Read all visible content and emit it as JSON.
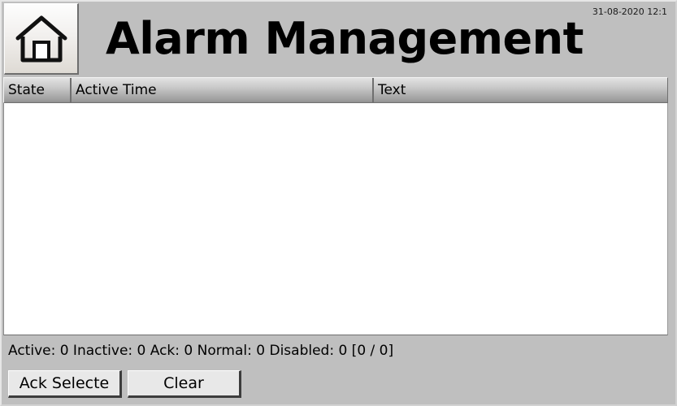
{
  "header": {
    "title": "Alarm Management",
    "home_icon": "home-icon",
    "timestamp": "31-08-2020 12:1"
  },
  "table": {
    "columns": [
      {
        "label": "State"
      },
      {
        "label": "Active Time"
      },
      {
        "label": "Text"
      }
    ],
    "rows": []
  },
  "status": {
    "text": "Active: 0  Inactive: 0  Ack: 0  Normal: 0 Disabled: 0  [0 / 0]",
    "active": 0,
    "inactive": 0,
    "ack": 0,
    "normal": 0,
    "disabled": 0,
    "page_indicator": "[0 / 0]"
  },
  "buttons": {
    "ack_selected": "Ack Selecte",
    "clear": "Clear"
  },
  "colors": {
    "window_background": "#bfbfbf",
    "list_background": "#ffffff",
    "header_gradient_top": "#e2e2e2",
    "header_gradient_bottom": "#8f8f8f",
    "button_face": "#e8e8e8",
    "text": "#000000"
  }
}
